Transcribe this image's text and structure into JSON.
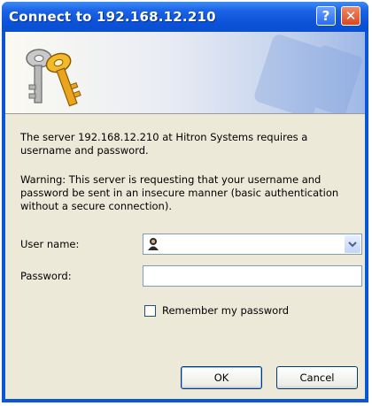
{
  "window": {
    "title": "Connect to 192.168.12.210"
  },
  "titlebar": {
    "help_glyph": "?",
    "close_glyph": "✕"
  },
  "message": {
    "line1": "The server 192.168.12.210 at Hitron Systems requires a",
    "line2": "username and password.",
    "warning1": "Warning: This server is requesting that your username and",
    "warning2": "password be sent in an insecure manner (basic authentication",
    "warning3": "without a secure connection)."
  },
  "form": {
    "username_label": "User name:",
    "username_value": "",
    "password_label": "Password:",
    "password_value": "",
    "remember_label": "Remember my password",
    "remember_checked": false
  },
  "buttons": {
    "ok": "OK",
    "cancel": "Cancel"
  },
  "icons": {
    "banner": "keys-icon",
    "user": "user-icon",
    "dropdown": "chevron-down-icon"
  },
  "colors": {
    "titlebar": "#0a56d8",
    "dialog_bg": "#ece9d8",
    "close": "#d8471e"
  }
}
